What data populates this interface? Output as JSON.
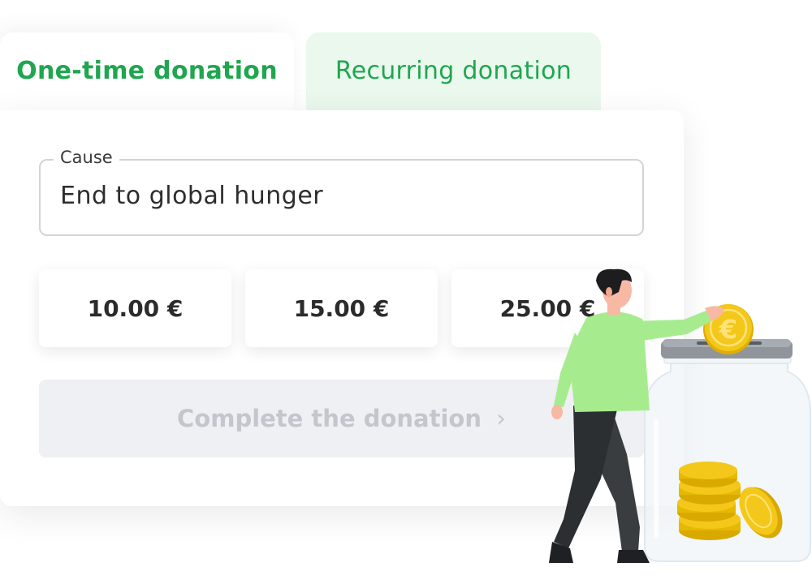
{
  "tabs": {
    "one_time": "One-time donation",
    "recurring": "Recurring donation"
  },
  "form": {
    "cause_label": "Cause",
    "cause_value": "End to global hunger",
    "amounts": [
      "10.00 €",
      "15.00 €",
      "25.00 €"
    ],
    "submit_label": "Complete the donation",
    "submit_icon": "chevron-right-icon"
  },
  "illustration": {
    "coin_symbol": "€"
  },
  "colors": {
    "accent_green": "#1fa64f",
    "inactive_tab_bg": "#eaf8ee",
    "disabled_button_bg": "#eef0f3",
    "disabled_button_text": "#c3c7cd",
    "coin_gold": "#f3c81a"
  }
}
